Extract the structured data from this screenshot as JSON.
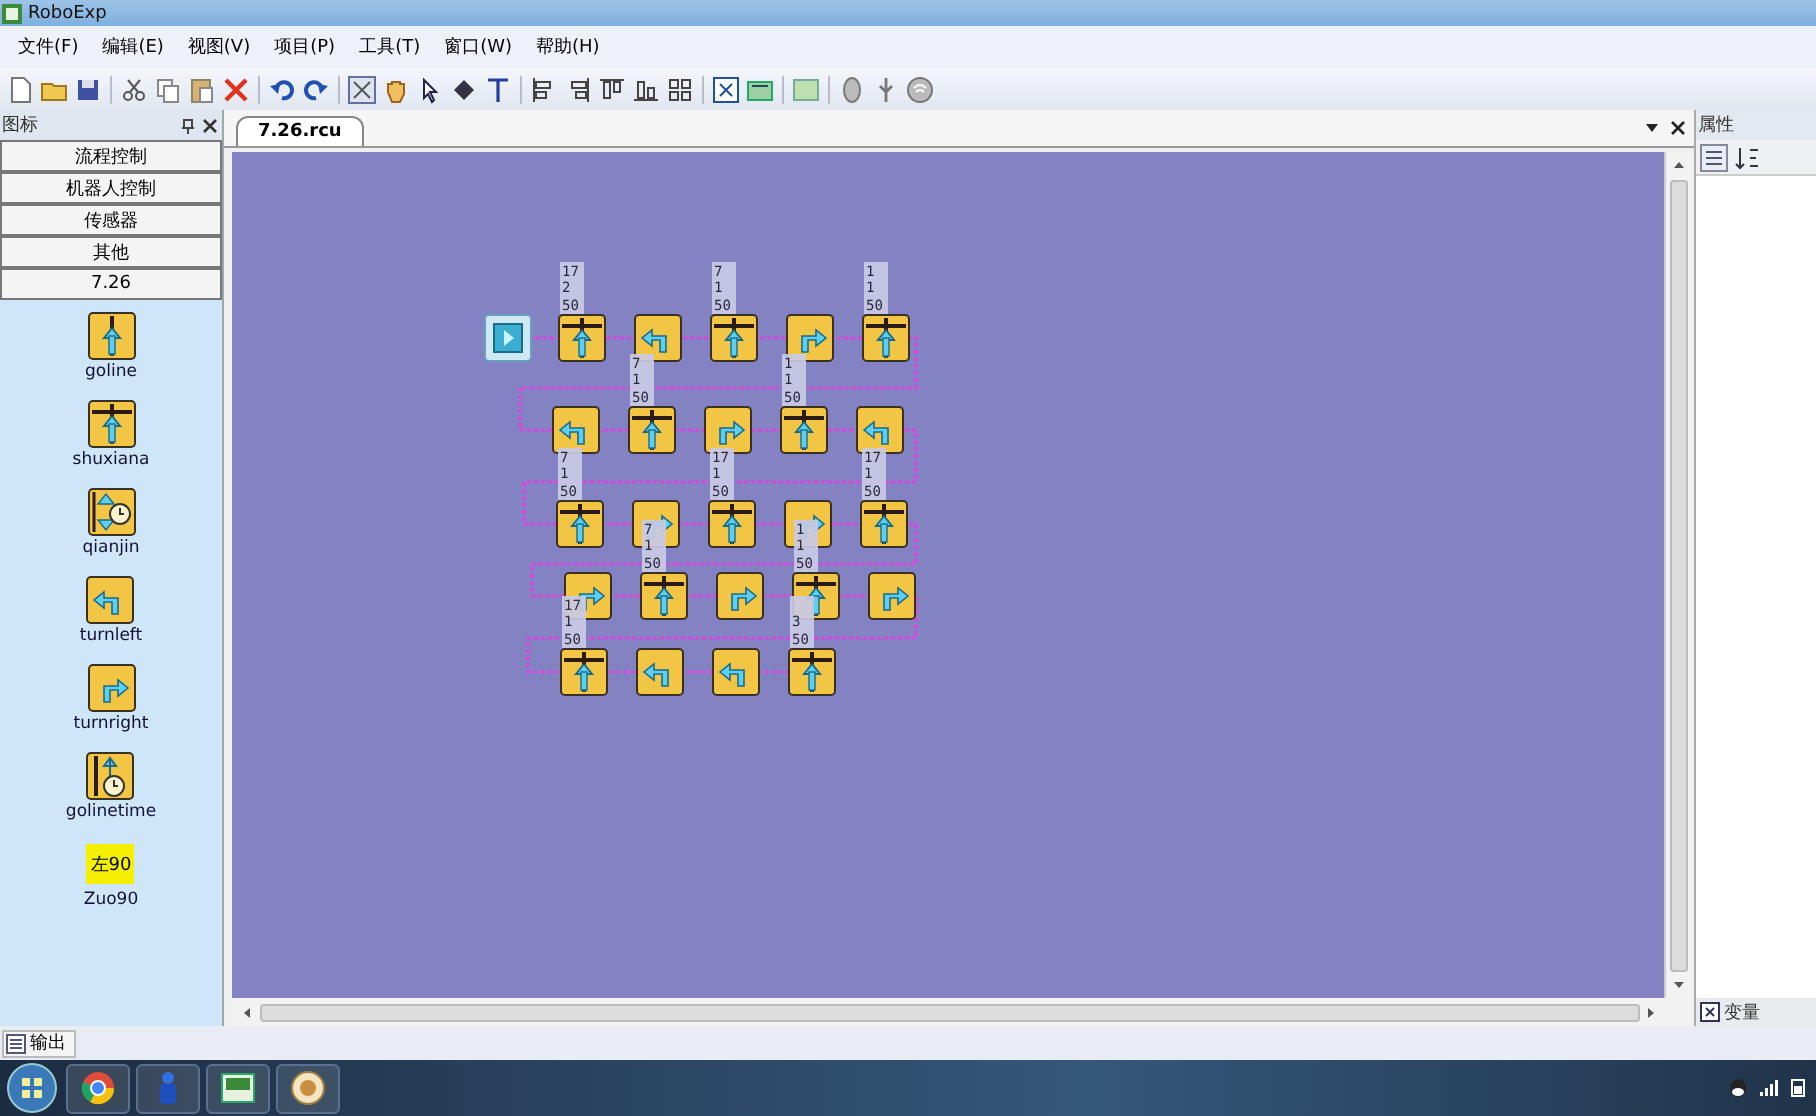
{
  "window": {
    "title": "RoboExp"
  },
  "menu": [
    {
      "label": "文件(F)"
    },
    {
      "label": "编辑(E)"
    },
    {
      "label": "视图(V)"
    },
    {
      "label": "项目(P)"
    },
    {
      "label": "工具(T)"
    },
    {
      "label": "窗口(W)"
    },
    {
      "label": "帮助(H)"
    }
  ],
  "toolbox": {
    "title": "图标",
    "categories": [
      {
        "label": "流程控制"
      },
      {
        "label": "机器人控制"
      },
      {
        "label": "传感器"
      },
      {
        "label": "其他"
      },
      {
        "label": "7.26"
      }
    ],
    "items": [
      {
        "kind": "goline",
        "label": "goline"
      },
      {
        "kind": "cross",
        "label": "shuxiana"
      },
      {
        "kind": "timer",
        "label": "qianjin"
      },
      {
        "kind": "left",
        "label": "turnleft"
      },
      {
        "kind": "right",
        "label": "turnright"
      },
      {
        "kind": "linetime",
        "label": "golinetime"
      },
      {
        "kind": "text",
        "text": "左90",
        "label": "Zuo90"
      }
    ]
  },
  "document_tab": {
    "title": "7.26.rcu"
  },
  "flow": {
    "start": {
      "kind": "start"
    },
    "rows": [
      [
        {
          "kind": "cross",
          "params": [
            "17",
            "2",
            "50"
          ]
        },
        {
          "kind": "left"
        },
        {
          "kind": "cross",
          "params": [
            "7",
            "1",
            "50"
          ]
        },
        {
          "kind": "right"
        },
        {
          "kind": "cross",
          "params": [
            "1",
            "1",
            "50"
          ]
        }
      ],
      [
        {
          "kind": "left"
        },
        {
          "kind": "cross",
          "params": [
            "7",
            "1",
            "50"
          ]
        },
        {
          "kind": "right"
        },
        {
          "kind": "cross",
          "params": [
            "1",
            "1",
            "50"
          ]
        },
        {
          "kind": "left"
        }
      ],
      [
        {
          "kind": "cross",
          "params": [
            "7",
            "1",
            "50"
          ]
        },
        {
          "kind": "right"
        },
        {
          "kind": "cross",
          "params": [
            "17",
            "1",
            "50"
          ]
        },
        {
          "kind": "right"
        },
        {
          "kind": "cross",
          "params": [
            "17",
            "1",
            "50"
          ]
        }
      ],
      [
        {
          "kind": "right"
        },
        {
          "kind": "cross",
          "params": [
            "7",
            "1",
            "50"
          ]
        },
        {
          "kind": "right"
        },
        {
          "kind": "cross",
          "params": [
            "1",
            "1",
            "50"
          ]
        },
        {
          "kind": "right"
        }
      ],
      [
        {
          "kind": "cross",
          "params": [
            "17",
            "1",
            "50"
          ]
        },
        {
          "kind": "left"
        },
        {
          "kind": "left"
        },
        {
          "kind": "cross",
          "params": [
            "3",
            "50"
          ]
        }
      ]
    ]
  },
  "properties_panel": {
    "title": "属性"
  },
  "variables_tab": {
    "label": "变量"
  },
  "output_tab": {
    "label": "输出"
  }
}
